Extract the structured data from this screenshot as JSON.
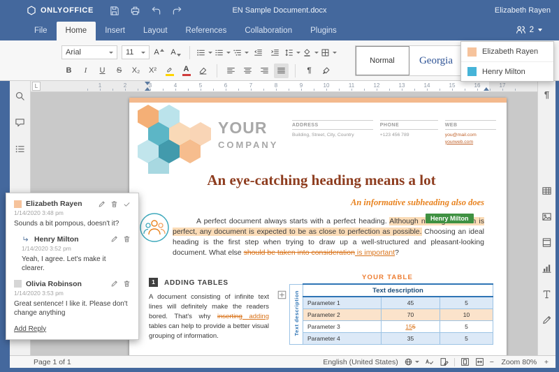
{
  "titlebar": {
    "app_name": "ONLYOFFICE",
    "document_title": "EN Sample Document.docx",
    "user_name": "Elizabeth Rayen"
  },
  "tabbar": {
    "tabs": [
      {
        "label": "File"
      },
      {
        "label": "Home"
      },
      {
        "label": "Insert"
      },
      {
        "label": "Layout"
      },
      {
        "label": "References"
      },
      {
        "label": "Collaboration"
      },
      {
        "label": "Plugins"
      }
    ],
    "active_tab": "Home",
    "users_count": "2"
  },
  "users_panel": {
    "users": [
      {
        "name": "Elizabeth Rayen",
        "color": "#f6c39c"
      },
      {
        "name": "Henry Milton",
        "color": "#46b4d8"
      }
    ]
  },
  "toolbar": {
    "font_name": "Arial",
    "font_size": "11",
    "font_inc_label": "A",
    "font_dec_label": "A",
    "bold_label": "B",
    "italic_label": "I",
    "underline_label": "U",
    "strike_label": "S",
    "subscript_label": "X₂",
    "superscript_label": "X²",
    "font_color_label": "A",
    "pilcrow_label": "¶",
    "styles": [
      {
        "name": "Normal"
      },
      {
        "name": "Georgia"
      }
    ]
  },
  "ruler": {
    "tab_selector": "L",
    "marks": [
      "1",
      "2",
      "3",
      "4",
      "5",
      "6",
      "7",
      "8",
      "9",
      "10",
      "11",
      "12",
      "13",
      "14",
      "15",
      "16",
      "17"
    ]
  },
  "page": {
    "company_line1": "YOUR",
    "company_line2": "COMPANY",
    "contact": {
      "address_header": "ADDRESS",
      "address_value": "Building, Street, City, Country",
      "phone_header": "PHONE",
      "phone_value": "+123 456 789",
      "web_header": "WEB",
      "web_value1": "you@mail.com",
      "web_value2": "yourweb.com"
    },
    "heading": "An eye-catching heading means a lot",
    "subheading": "An informative subheading also does",
    "collab_tag": "Henry Milton",
    "intro": {
      "part1": "A perfect document always starts with a perfect heading. ",
      "highlighted": "Although nothing on earth is perfect, any document is expected to be as close to perfection as possible.",
      "part2": " Choosing an ideal heading is the first step when trying to draw up a well-structured and pleasant-looking document. What else ",
      "deleted": "should be taken into consideration",
      "inserted": " is important",
      "part3": "?"
    },
    "section_number": "1",
    "section_title": "ADDING TABLES",
    "side_paragraph": {
      "part1": "A document consisting of infinite text lines will definitely make the readers bored. That's why ",
      "deleted": "inserting",
      "inserted": " adding",
      "part2": " tables can help to provide a better visual grouping of information."
    },
    "table": {
      "caption": "YOUR TABLE",
      "rotated_label": "Text description",
      "header": "Text description",
      "rows": [
        {
          "name": "Parameter 1",
          "v1": "45",
          "v2": "5"
        },
        {
          "name": "Parameter 2",
          "v1": "70",
          "v2": "10"
        },
        {
          "name": "Parameter 3",
          "v1_ins": "15",
          "v1_del": "5",
          "v2": "5"
        },
        {
          "name": "Parameter 4",
          "v1": "35",
          "v2": "5"
        }
      ]
    }
  },
  "comments": {
    "thread": [
      {
        "author": "Elizabeth Rayen",
        "date": "1/14/2020 3:48 pm",
        "text": "Sounds a bit pompous, doesn't it?"
      },
      {
        "author": "Henry Milton",
        "date": "1/14/2020 3:52 pm",
        "text": "Yeah, I agree. Let's make it clearer."
      },
      {
        "author": "Olivia Robinson",
        "date": "1/14/2020 3:53 pm",
        "text": "Great sentence! I like it. Please don't change anything"
      }
    ],
    "add_reply_label": "Add Reply"
  },
  "statusbar": {
    "page_info": "Page 1 of 1",
    "language": "English (United States)",
    "zoom_out": "−",
    "zoom_label": "Zoom 80%",
    "zoom_in": "+"
  },
  "colors": {
    "top_bar": "#44689d",
    "collab_green": "#3f9142",
    "comment_highlight": "#fbdcb7",
    "track_change": "#d9731a",
    "heading": "#8e3d1f",
    "subheading": "#e8821e",
    "table_accent": "#2e74b5",
    "user_elizabeth": "#f6c39c",
    "user_henry": "#46b4d8",
    "user_olivia": "#d6d6d6"
  }
}
